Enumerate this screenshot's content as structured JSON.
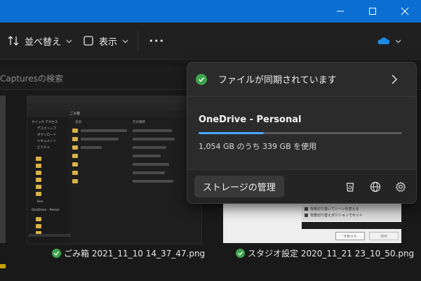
{
  "toolbar": {
    "sort_label": "並べ替え",
    "view_label": "表示",
    "more_label": "•••"
  },
  "search": {
    "placeholder": "Capturesの検索"
  },
  "files": [
    {
      "name": "ごみ箱 2021_11_10 14_37_47.png"
    },
    {
      "name": "スタジオ設定 2020_11_21 23_10_50.png"
    }
  ],
  "onedrive_flyout": {
    "status": "ファイルが同期されています",
    "account": "OneDrive - Personal",
    "usage_text": "1,054 GB のうち 339 GB を使用",
    "usage_fraction": 0.32,
    "manage_storage_label": "ストレージの管理"
  },
  "thumb1": {
    "tree_quick": "クイック アクセス",
    "tree_desktop": "デスクトップ",
    "tree_download": "ダウンロード",
    "tree_docs": "ドキュメント",
    "tree_pics": "ピクチャ",
    "tree_box": "Box",
    "tree_onedrive": "OneDrive - Persor",
    "col_name": "名前",
    "col_location": "元の場所",
    "path": "ごみ箱"
  },
  "thumb2": {
    "line1": "背景切り抜いてシーンを変える",
    "line2": "背景切り替えポジションでセット",
    "reset_label": "リセット",
    "apply_label": "適用"
  },
  "colors": {
    "titlebar": "#0a6fd0",
    "accent": "#4aa8ff",
    "sync_ok": "#3fa34d",
    "onedrive_cloud": "#1a8ce6"
  }
}
